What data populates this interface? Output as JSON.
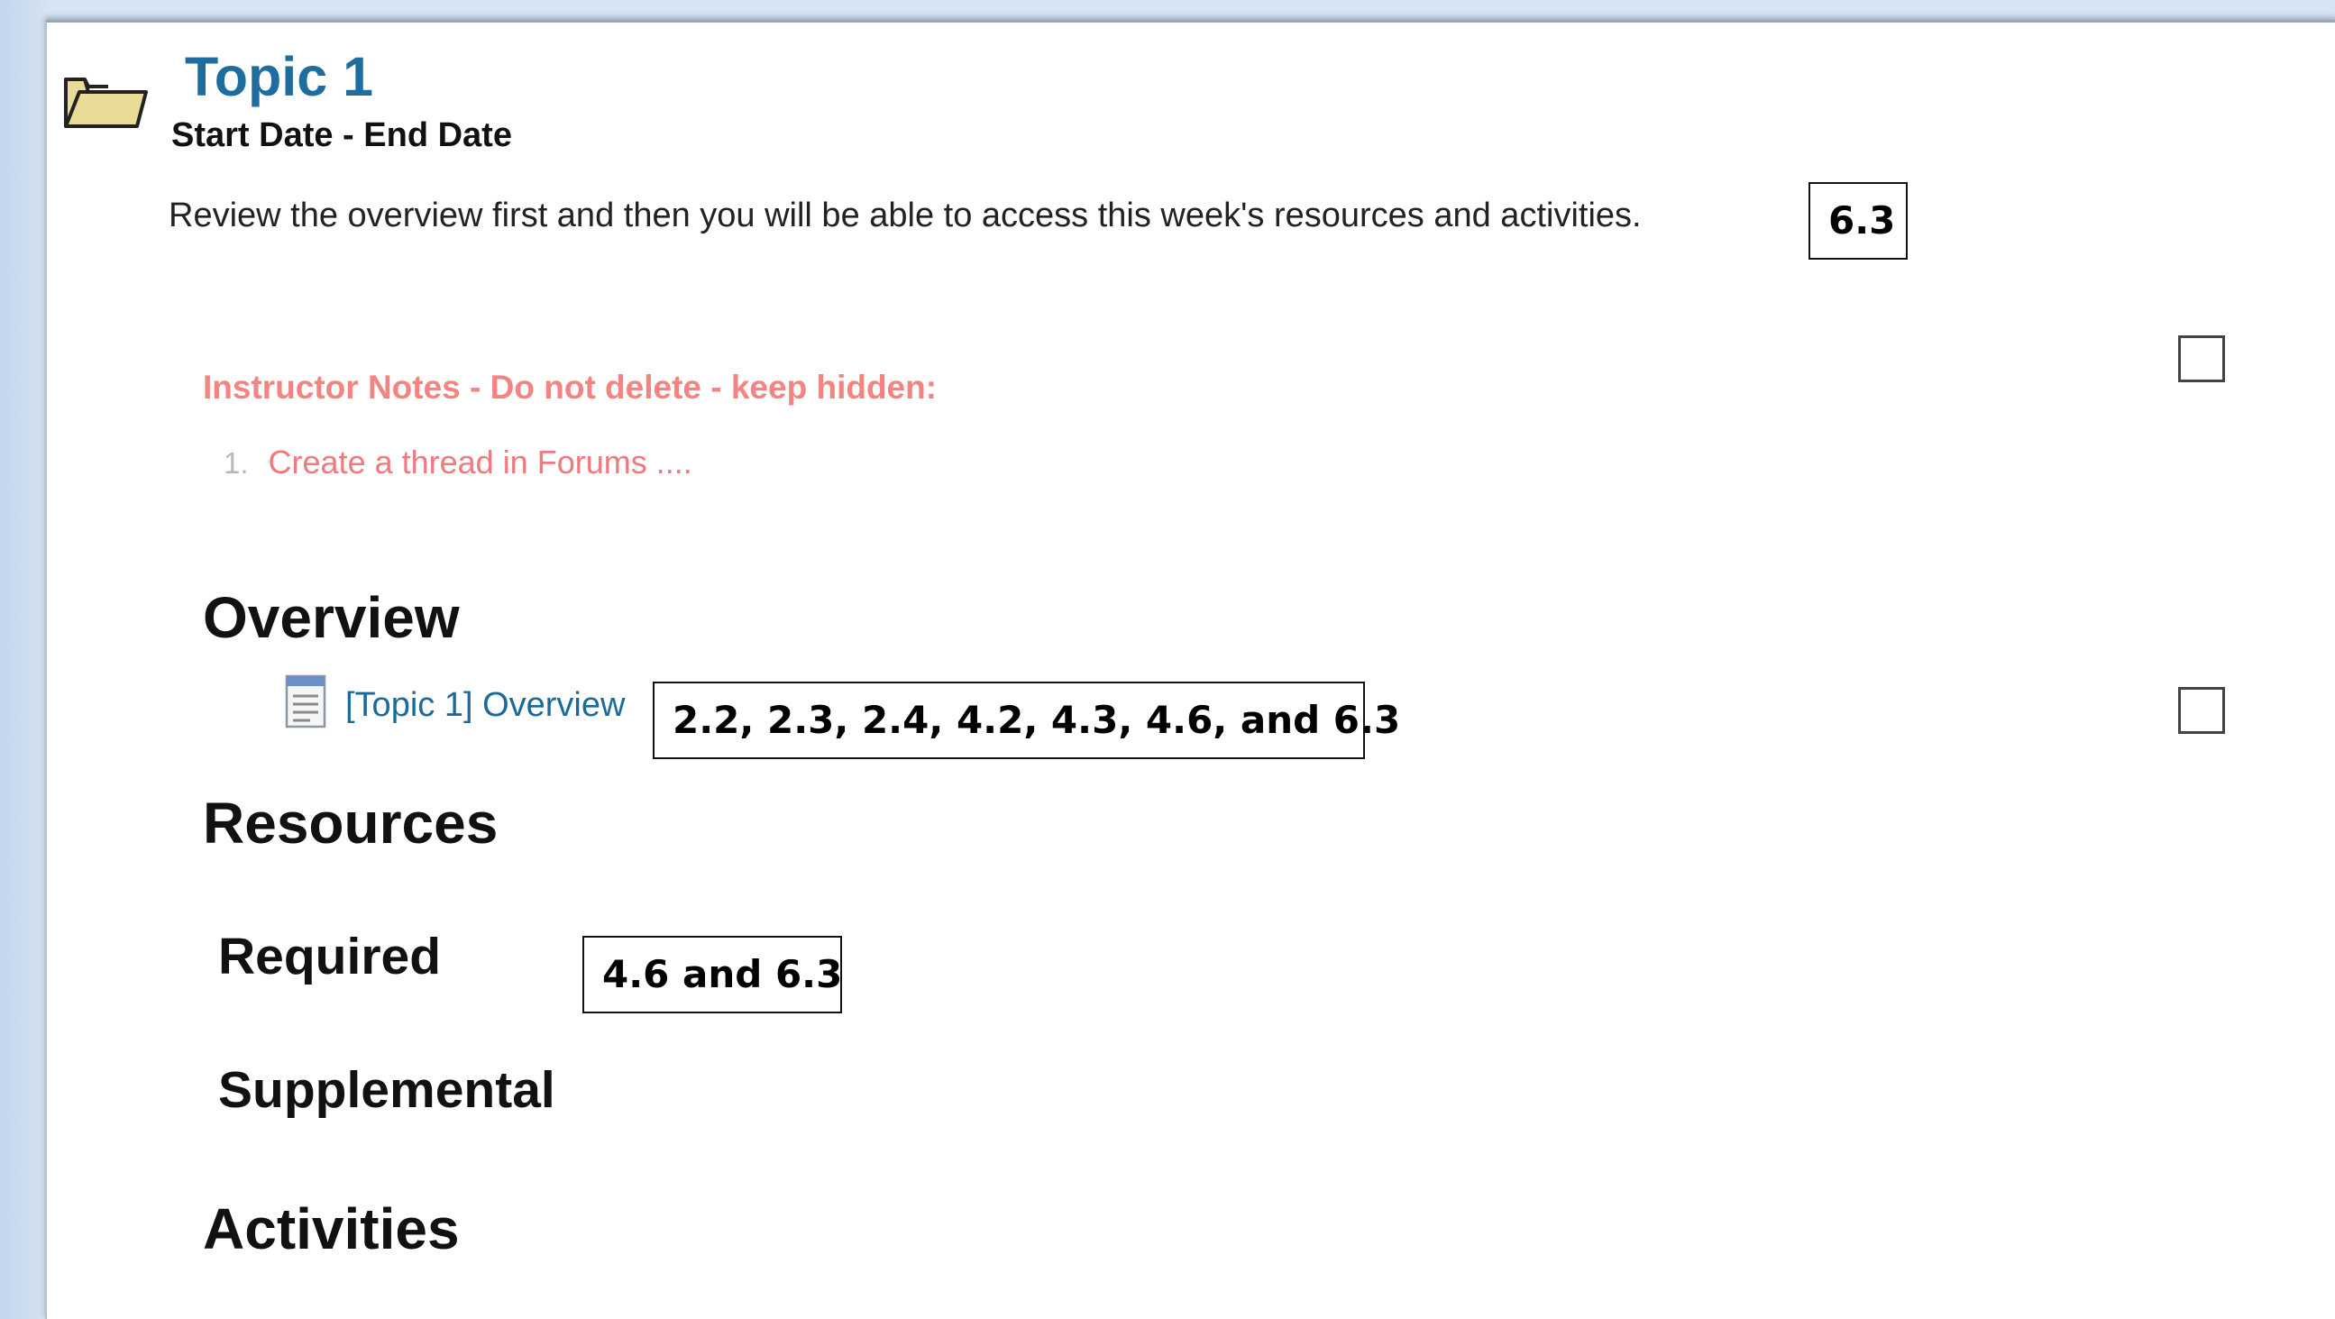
{
  "topic": {
    "title": "Topic 1",
    "dates": "Start Date - End Date",
    "summary": "Review the overview first and then you will be able to access this week's resources and activities."
  },
  "annotations": {
    "summary_standard": "6.3",
    "overview_standards": "2.2, 2.3, 2.4, 4.2, 4.3, 4.6, and 6.3",
    "required_standards": "4.6 and 6.3"
  },
  "instructor_notes": {
    "heading": "Instructor Notes - Do not delete - keep hidden:",
    "items": [
      {
        "number": "1.",
        "text": "Create a thread in Forums ...."
      }
    ]
  },
  "sections": {
    "overview": "Overview",
    "overview_link": "[Topic 1] Overview",
    "resources": "Resources",
    "required": "Required",
    "supplemental": "Supplemental",
    "activities": "Activities"
  },
  "icons": {
    "topic": "folder-icon",
    "overview_link": "page-icon"
  },
  "colors": {
    "topic_title": "#1f6d9e",
    "link": "#1b6a9a",
    "instructor_notes": "#f28482",
    "background": "#d6e4f3"
  }
}
